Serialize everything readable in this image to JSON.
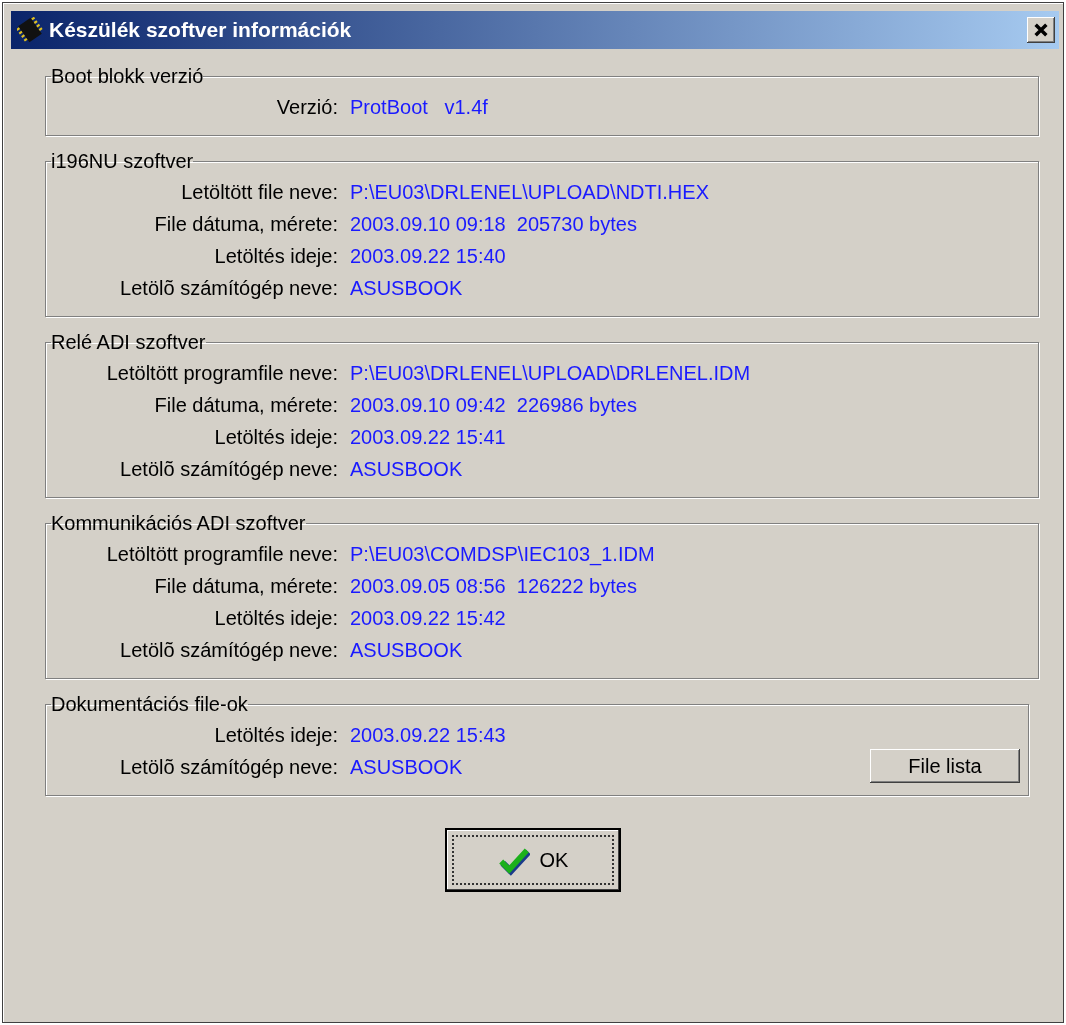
{
  "window": {
    "title": "Készülék szoftver információk"
  },
  "groups": [
    {
      "title": "Boot blokk verzió",
      "rows": [
        {
          "label": "Verzió:",
          "value": "ProtBoot   v1.4f"
        }
      ]
    },
    {
      "title": "i196NU szoftver",
      "rows": [
        {
          "label": "Letöltött file neve:",
          "value": "P:\\EU03\\DRLENEL\\UPLOAD\\NDTI.HEX"
        },
        {
          "label": "File dátuma, mérete:",
          "value": "2003.09.10 09:18  205730 bytes"
        },
        {
          "label": "Letöltés ideje:",
          "value": "2003.09.22 15:40"
        },
        {
          "label": "Letölõ számítógép neve:",
          "value": "ASUSBOOK"
        }
      ]
    },
    {
      "title": "Relé ADI szoftver",
      "rows": [
        {
          "label": "Letöltött programfile neve:",
          "value": "P:\\EU03\\DRLENEL\\UPLOAD\\DRLENEL.IDM"
        },
        {
          "label": "File dátuma, mérete:",
          "value": "2003.09.10 09:42  226986 bytes"
        },
        {
          "label": "Letöltés ideje:",
          "value": "2003.09.22 15:41"
        },
        {
          "label": "Letölõ számítógép neve:",
          "value": "ASUSBOOK"
        }
      ]
    },
    {
      "title": "Kommunikációs ADI szoftver",
      "rows": [
        {
          "label": "Letöltött programfile neve:",
          "value": "P:\\EU03\\COMDSP\\IEC103_1.IDM"
        },
        {
          "label": "File dátuma, mérete:",
          "value": "2003.09.05 08:56  126222 bytes"
        },
        {
          "label": "Letöltés ideje:",
          "value": "2003.09.22 15:42"
        },
        {
          "label": "Letölõ számítógép neve:",
          "value": "ASUSBOOK"
        }
      ]
    },
    {
      "title": "Dokumentációs file-ok",
      "rows": [
        {
          "label": "Letöltés ideje:",
          "value": "2003.09.22 15:43"
        },
        {
          "label": "Letölõ számítógép neve:",
          "value": "ASUSBOOK"
        }
      ],
      "button": "File lista"
    }
  ],
  "ok_button": "OK"
}
